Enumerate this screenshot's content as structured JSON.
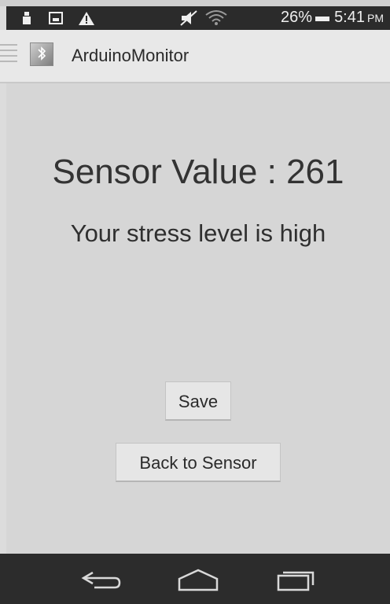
{
  "status_bar": {
    "battery_percent": "26%",
    "time": "5:41",
    "ampm": "PM",
    "icons": [
      "alert-icon-1",
      "image-icon",
      "warning-icon",
      "mute-icon",
      "wifi-icon",
      "battery-icon"
    ]
  },
  "action_bar": {
    "title": "ArduinoMonitor",
    "icons": [
      "drawer-icon",
      "app-icon"
    ]
  },
  "main": {
    "sensor_label": "Sensor Value : ",
    "sensor_value": "261",
    "stress_message": "Your stress level is high"
  },
  "buttons": {
    "save_label": "Save",
    "back_label": "Back to Sensor"
  },
  "nav_bar": {
    "icons": [
      "back-icon",
      "home-icon",
      "recent-apps-icon"
    ]
  }
}
